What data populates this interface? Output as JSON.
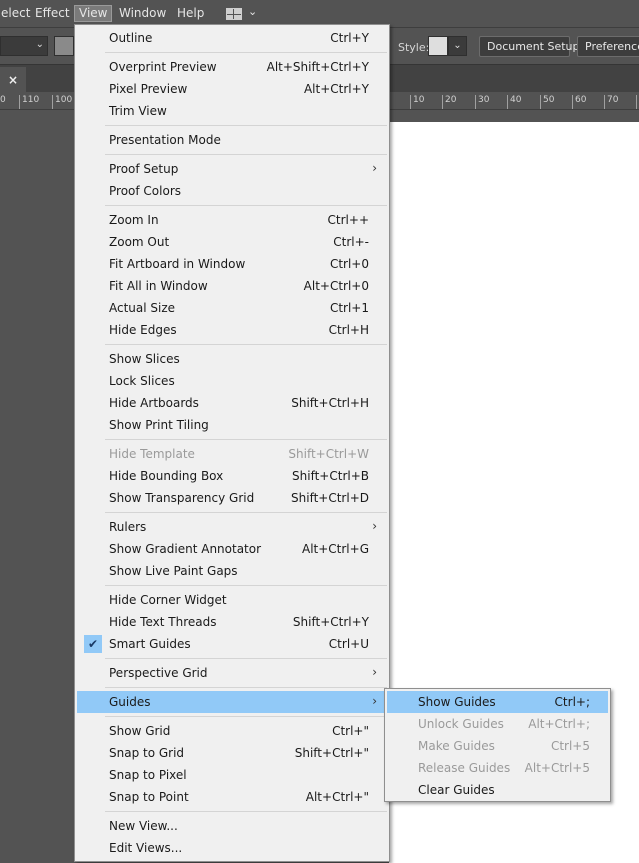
{
  "menubar": {
    "items": [
      "elect",
      "Effect",
      "View",
      "Window",
      "Help"
    ],
    "active": "View"
  },
  "controlbar": {
    "style_label": "Style:",
    "document_setup": "Document Setup",
    "preferences": "Preferences"
  },
  "tab": {
    "close": "×"
  },
  "ruler": {
    "labels": [
      "0",
      "110",
      "100",
      "10",
      "20",
      "30",
      "40",
      "50",
      "60",
      "70"
    ]
  },
  "view_menu": {
    "items": [
      {
        "label": "Outline",
        "shortcut": "Ctrl+Y"
      },
      {
        "label": "Overprint Preview",
        "shortcut": "Alt+Shift+Ctrl+Y"
      },
      {
        "label": "Pixel Preview",
        "shortcut": "Alt+Ctrl+Y"
      },
      {
        "label": "Trim View",
        "shortcut": ""
      },
      {
        "label": "Presentation Mode",
        "shortcut": ""
      },
      {
        "label": "Proof Setup",
        "shortcut": "",
        "submenu": true
      },
      {
        "label": "Proof Colors",
        "shortcut": ""
      },
      {
        "label": "Zoom In",
        "shortcut": "Ctrl++"
      },
      {
        "label": "Zoom Out",
        "shortcut": "Ctrl+-"
      },
      {
        "label": "Fit Artboard in Window",
        "shortcut": "Ctrl+0"
      },
      {
        "label": "Fit All in Window",
        "shortcut": "Alt+Ctrl+0"
      },
      {
        "label": "Actual Size",
        "shortcut": "Ctrl+1"
      },
      {
        "label": "Hide Edges",
        "shortcut": "Ctrl+H"
      },
      {
        "label": "Show Slices",
        "shortcut": ""
      },
      {
        "label": "Lock Slices",
        "shortcut": ""
      },
      {
        "label": "Hide Artboards",
        "shortcut": "Shift+Ctrl+H"
      },
      {
        "label": "Show Print Tiling",
        "shortcut": ""
      },
      {
        "label": "Hide Template",
        "shortcut": "Shift+Ctrl+W",
        "disabled": true
      },
      {
        "label": "Hide Bounding Box",
        "shortcut": "Shift+Ctrl+B"
      },
      {
        "label": "Show Transparency Grid",
        "shortcut": "Shift+Ctrl+D"
      },
      {
        "label": "Rulers",
        "shortcut": "",
        "submenu": true
      },
      {
        "label": "Show Gradient Annotator",
        "shortcut": "Alt+Ctrl+G"
      },
      {
        "label": "Show Live Paint Gaps",
        "shortcut": ""
      },
      {
        "label": "Hide Corner Widget",
        "shortcut": ""
      },
      {
        "label": "Hide Text Threads",
        "shortcut": "Shift+Ctrl+Y"
      },
      {
        "label": "Smart Guides",
        "shortcut": "Ctrl+U",
        "checked": true
      },
      {
        "label": "Perspective Grid",
        "shortcut": "",
        "submenu": true
      },
      {
        "label": "Guides",
        "shortcut": "",
        "submenu": true,
        "highlighted": true
      },
      {
        "label": "Show Grid",
        "shortcut": "Ctrl+\""
      },
      {
        "label": "Snap to Grid",
        "shortcut": "Shift+Ctrl+\""
      },
      {
        "label": "Snap to Pixel",
        "shortcut": ""
      },
      {
        "label": "Snap to Point",
        "shortcut": "Alt+Ctrl+\""
      },
      {
        "label": "New View...",
        "shortcut": ""
      },
      {
        "label": "Edit Views...",
        "shortcut": ""
      }
    ]
  },
  "guides_submenu": {
    "items": [
      {
        "label": "Show Guides",
        "shortcut": "Ctrl+;",
        "highlighted": true
      },
      {
        "label": "Unlock Guides",
        "shortcut": "Alt+Ctrl+;",
        "disabled": true
      },
      {
        "label": "Make Guides",
        "shortcut": "Ctrl+5",
        "disabled": true
      },
      {
        "label": "Release Guides",
        "shortcut": "Alt+Ctrl+5",
        "disabled": true
      },
      {
        "label": "Clear Guides",
        "shortcut": ""
      }
    ]
  },
  "colors": {
    "chrome": "#535353",
    "menu_bg": "#f0f0f0",
    "highlight": "#91c9f7",
    "disabled_text": "#9a9a9a"
  }
}
